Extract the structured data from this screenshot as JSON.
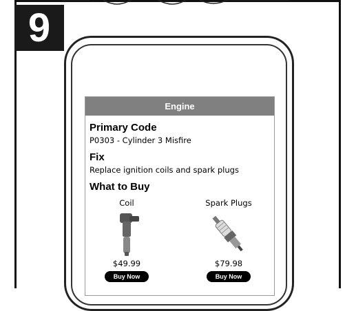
{
  "step": {
    "number": "9"
  },
  "screen": {
    "header": "Engine",
    "primary_code": {
      "title": "Primary Code",
      "text": "P0303 - Cylinder 3 Misfire"
    },
    "fix": {
      "title": "Fix",
      "text": "Replace ignition coils and spark plugs"
    },
    "what_to_buy": {
      "title": "What to Buy"
    },
    "products": [
      {
        "name": "Coil",
        "price": "$49.99",
        "button": "Buy Now",
        "icon": "ignition-coil-icon"
      },
      {
        "name": "Spark Plugs",
        "price": "$79.98",
        "button": "Buy Now",
        "icon": "spark-plug-icon"
      }
    ]
  },
  "colors": {
    "header_bg": "#808080",
    "badge_bg": "#1a1a1a",
    "button_bg": "#000000"
  }
}
